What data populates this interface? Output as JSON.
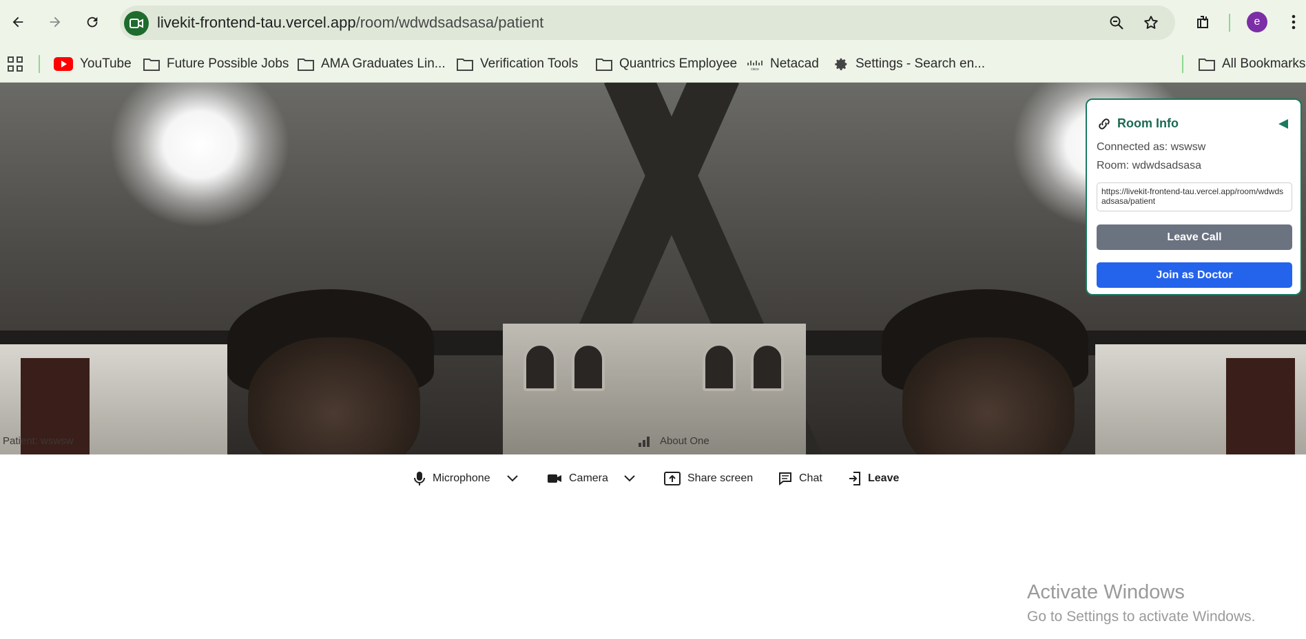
{
  "browser": {
    "url_host": "livekit-frontend-tau.vercel.app",
    "url_path": "/room/wdwdsadsasa/patient",
    "avatar_letter": "e"
  },
  "bookmarks": [
    {
      "label": "YouTube",
      "icon": "youtube-icon"
    },
    {
      "label": "Future Possible Jobs",
      "icon": "folder-icon"
    },
    {
      "label": "AMA Graduates Lin...",
      "icon": "folder-icon"
    },
    {
      "label": "Verification Tools",
      "icon": "folder-icon"
    },
    {
      "label": "Quantrics Employee",
      "icon": "folder-icon"
    },
    {
      "label": "Netacad",
      "icon": "cisco-icon"
    },
    {
      "label": "Settings - Search en...",
      "icon": "gear-icon"
    }
  ],
  "all_bookmarks_label": "All Bookmarks",
  "video": {
    "participant_label": "Patient: wswsw",
    "center_label": "About One"
  },
  "room_info": {
    "title": "Room Info",
    "connected_as": "Connected as: wswsw",
    "room": "Room: wdwdsadsasa",
    "share_url": "https://livekit-frontend-tau.vercel.app/room/wdwdsadsasa/patient",
    "leave_call_label": "Leave Call",
    "join_doctor_label": "Join as Doctor"
  },
  "controls": {
    "microphone": "Microphone",
    "camera": "Camera",
    "share_screen": "Share screen",
    "chat": "Chat",
    "leave": "Leave"
  },
  "watermark": {
    "title": "Activate Windows",
    "subtitle": "Go to Settings to activate Windows."
  },
  "colors": {
    "accent_green": "#1a7a5e",
    "join_blue": "#2463eb",
    "leave_gray": "#6b7280"
  }
}
